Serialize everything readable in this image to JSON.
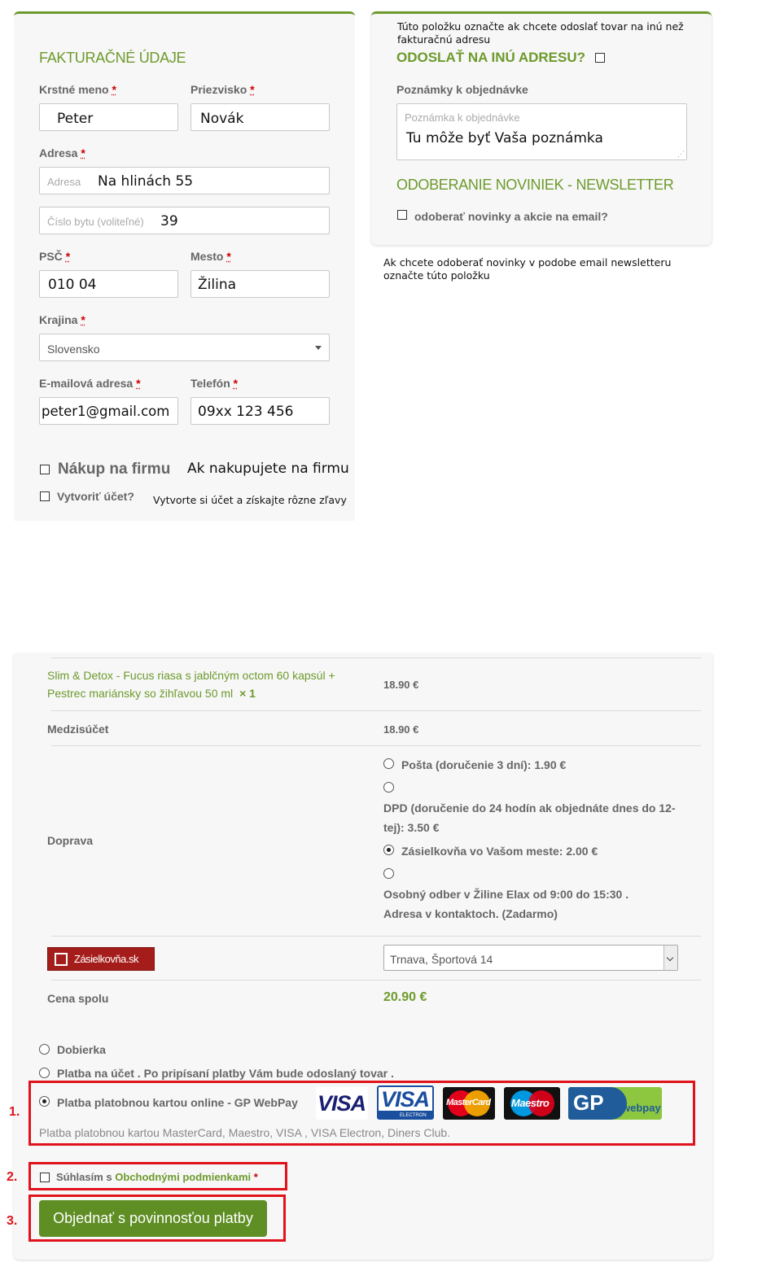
{
  "billing": {
    "heading": "FAKTURAČNÉ ÚDAJE",
    "first_name_label": "Krstné meno",
    "first_name_value": "Peter",
    "last_name_label": "Priezvisko",
    "last_name_value": "Novák",
    "address_label": "Adresa",
    "address_placeholder": "Adresa",
    "address_value": "Na hlinách 55",
    "apartment_placeholder": "Číslo bytu (voliteľné)",
    "apartment_value": "39",
    "zip_label": "PSČ",
    "zip_value": "010 04",
    "city_label": "Mesto",
    "city_value": "Žilina",
    "country_label": "Krajina",
    "country_value": "Slovensko",
    "email_label": "E-mailová adresa",
    "email_value": "peter1@gmail.com",
    "phone_label": "Telefón",
    "phone_value": "09xx 123 456",
    "company_label": "Nákup na firmu",
    "company_note": "Ak nakupujete na firmu",
    "account_label": "Vytvoriť účet?",
    "account_note": "Vytvorte si účet a získajte rôzne zľavy",
    "required_mark": "*"
  },
  "shipping": {
    "top_note": "Túto položku označte ak chcete odoslať tovar na inú než fakturačnú adresu",
    "ship_other_label": "ODOSLAŤ NA INÚ ADRESU?",
    "notes_label": "Poznámky k objednávke",
    "notes_placeholder": "Poznámka k objednávke",
    "notes_value": "Tu môže byť Vaša poznámka",
    "newsletter_heading": "ODOBERANIE NOVINIEK - NEWSLETTER",
    "newsletter_label": "odoberať novinky a akcie na email?",
    "newsletter_note": "Ak chcete odoberať novinky v podobe email newsletteru označte túto položku"
  },
  "order": {
    "product_name": "Slim & Detox - Fucus riasa s jablčným octom 60 kapsúl + Pestrec mariánsky so žihľavou 50 ml",
    "product_qty": "× 1",
    "product_price": "18.90 €",
    "subtotal_label": "Medzisúčet",
    "subtotal_value": "18.90 €",
    "shipping_label": "Doprava",
    "shipping_options": [
      {
        "label": "Pošta (doručenie 3 dní): 1.90 €",
        "selected": false
      },
      {
        "label": "DPD (doručenie do 24 hodín ak objednáte dnes do 12-tej): 3.50 €",
        "selected": false
      },
      {
        "label": "Zásielkovňa vo Vašom meste: 2.00 €",
        "selected": true
      },
      {
        "label": "Osobný odber v Žiline Elax od 9:00 do 15:30 . Adresa v kontaktoch. (Zadarmo)",
        "selected": false
      }
    ],
    "zasielkovna_logo": "Zásielkovňa.sk",
    "pickup_point": "Trnava, Športová 14",
    "total_label": "Cena spolu",
    "total_value": "20.90 €"
  },
  "payment": {
    "options": [
      {
        "label": "Dobierka",
        "selected": false
      },
      {
        "label": "Platba na účet . Po pripísaní platby Vám bude odoslaný tovar .",
        "selected": false
      },
      {
        "label": "Platba platobnou kartou online - GP WebPay",
        "selected": true
      }
    ],
    "card_description": "Platba platobnou kartou MasterCard, Maestro, VISA , VISA Electron, Diners Club.",
    "cards": {
      "visa": "VISA",
      "visa_electron": "VISA",
      "visa_electron_sub": "ELECTRON",
      "mastercard": "MasterCard",
      "maestro": "Maestro",
      "gp": "GP",
      "gp_sub": "webpay"
    },
    "terms_prefix": "Súhlasím s",
    "terms_link": "Obchodnými podmienkami",
    "submit_label": "Objednať s povinnosťou platby"
  },
  "annotations": {
    "step1": "1.",
    "step2": "2.",
    "step3": "3."
  },
  "colors": {
    "accent_green": "#6d9a2c",
    "annotation_red": "#e0121c"
  }
}
